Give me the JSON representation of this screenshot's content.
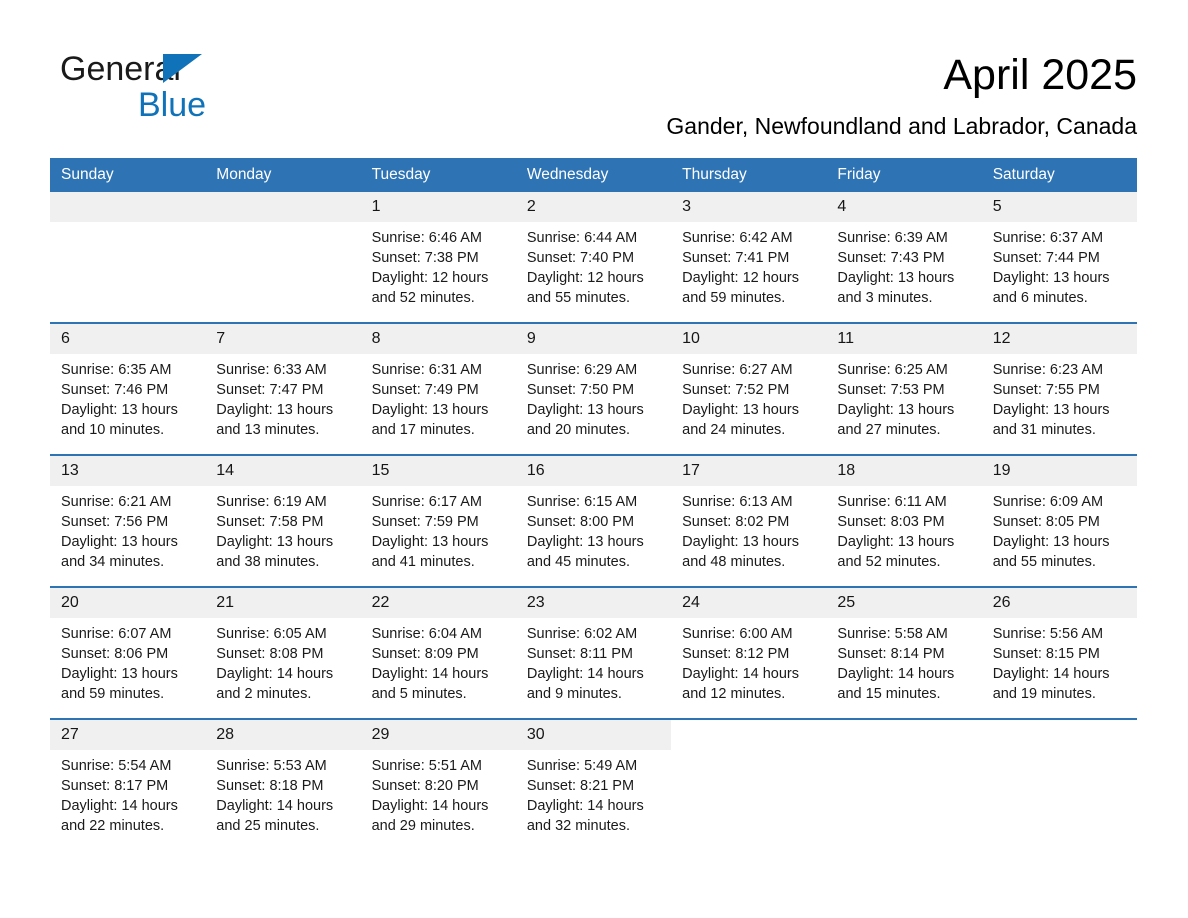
{
  "brand": {
    "word1": "General",
    "word2": "Blue",
    "accent_color": "#1073b9"
  },
  "header": {
    "title": "April 2025",
    "subtitle": "Gander, Newfoundland and Labrador, Canada"
  },
  "theme": {
    "header_bg": "#2e73b3",
    "daynum_bg": "#f0f0f0",
    "page_bg": "#ffffff"
  },
  "weekday_headers": [
    "Sunday",
    "Monday",
    "Tuesday",
    "Wednesday",
    "Thursday",
    "Friday",
    "Saturday"
  ],
  "weeks": [
    [
      {
        "day": "",
        "blank": true,
        "sunrise": "",
        "sunset": "",
        "daylight1": "",
        "daylight2": ""
      },
      {
        "day": "",
        "blank": true,
        "sunrise": "",
        "sunset": "",
        "daylight1": "",
        "daylight2": ""
      },
      {
        "day": "1",
        "sunrise": "Sunrise: 6:46 AM",
        "sunset": "Sunset: 7:38 PM",
        "daylight1": "Daylight: 12 hours",
        "daylight2": "and 52 minutes."
      },
      {
        "day": "2",
        "sunrise": "Sunrise: 6:44 AM",
        "sunset": "Sunset: 7:40 PM",
        "daylight1": "Daylight: 12 hours",
        "daylight2": "and 55 minutes."
      },
      {
        "day": "3",
        "sunrise": "Sunrise: 6:42 AM",
        "sunset": "Sunset: 7:41 PM",
        "daylight1": "Daylight: 12 hours",
        "daylight2": "and 59 minutes."
      },
      {
        "day": "4",
        "sunrise": "Sunrise: 6:39 AM",
        "sunset": "Sunset: 7:43 PM",
        "daylight1": "Daylight: 13 hours",
        "daylight2": "and 3 minutes."
      },
      {
        "day": "5",
        "sunrise": "Sunrise: 6:37 AM",
        "sunset": "Sunset: 7:44 PM",
        "daylight1": "Daylight: 13 hours",
        "daylight2": "and 6 minutes."
      }
    ],
    [
      {
        "day": "6",
        "sunrise": "Sunrise: 6:35 AM",
        "sunset": "Sunset: 7:46 PM",
        "daylight1": "Daylight: 13 hours",
        "daylight2": "and 10 minutes."
      },
      {
        "day": "7",
        "sunrise": "Sunrise: 6:33 AM",
        "sunset": "Sunset: 7:47 PM",
        "daylight1": "Daylight: 13 hours",
        "daylight2": "and 13 minutes."
      },
      {
        "day": "8",
        "sunrise": "Sunrise: 6:31 AM",
        "sunset": "Sunset: 7:49 PM",
        "daylight1": "Daylight: 13 hours",
        "daylight2": "and 17 minutes."
      },
      {
        "day": "9",
        "sunrise": "Sunrise: 6:29 AM",
        "sunset": "Sunset: 7:50 PM",
        "daylight1": "Daylight: 13 hours",
        "daylight2": "and 20 minutes."
      },
      {
        "day": "10",
        "sunrise": "Sunrise: 6:27 AM",
        "sunset": "Sunset: 7:52 PM",
        "daylight1": "Daylight: 13 hours",
        "daylight2": "and 24 minutes."
      },
      {
        "day": "11",
        "sunrise": "Sunrise: 6:25 AM",
        "sunset": "Sunset: 7:53 PM",
        "daylight1": "Daylight: 13 hours",
        "daylight2": "and 27 minutes."
      },
      {
        "day": "12",
        "sunrise": "Sunrise: 6:23 AM",
        "sunset": "Sunset: 7:55 PM",
        "daylight1": "Daylight: 13 hours",
        "daylight2": "and 31 minutes."
      }
    ],
    [
      {
        "day": "13",
        "sunrise": "Sunrise: 6:21 AM",
        "sunset": "Sunset: 7:56 PM",
        "daylight1": "Daylight: 13 hours",
        "daylight2": "and 34 minutes."
      },
      {
        "day": "14",
        "sunrise": "Sunrise: 6:19 AM",
        "sunset": "Sunset: 7:58 PM",
        "daylight1": "Daylight: 13 hours",
        "daylight2": "and 38 minutes."
      },
      {
        "day": "15",
        "sunrise": "Sunrise: 6:17 AM",
        "sunset": "Sunset: 7:59 PM",
        "daylight1": "Daylight: 13 hours",
        "daylight2": "and 41 minutes."
      },
      {
        "day": "16",
        "sunrise": "Sunrise: 6:15 AM",
        "sunset": "Sunset: 8:00 PM",
        "daylight1": "Daylight: 13 hours",
        "daylight2": "and 45 minutes."
      },
      {
        "day": "17",
        "sunrise": "Sunrise: 6:13 AM",
        "sunset": "Sunset: 8:02 PM",
        "daylight1": "Daylight: 13 hours",
        "daylight2": "and 48 minutes."
      },
      {
        "day": "18",
        "sunrise": "Sunrise: 6:11 AM",
        "sunset": "Sunset: 8:03 PM",
        "daylight1": "Daylight: 13 hours",
        "daylight2": "and 52 minutes."
      },
      {
        "day": "19",
        "sunrise": "Sunrise: 6:09 AM",
        "sunset": "Sunset: 8:05 PM",
        "daylight1": "Daylight: 13 hours",
        "daylight2": "and 55 minutes."
      }
    ],
    [
      {
        "day": "20",
        "sunrise": "Sunrise: 6:07 AM",
        "sunset": "Sunset: 8:06 PM",
        "daylight1": "Daylight: 13 hours",
        "daylight2": "and 59 minutes."
      },
      {
        "day": "21",
        "sunrise": "Sunrise: 6:05 AM",
        "sunset": "Sunset: 8:08 PM",
        "daylight1": "Daylight: 14 hours",
        "daylight2": "and 2 minutes."
      },
      {
        "day": "22",
        "sunrise": "Sunrise: 6:04 AM",
        "sunset": "Sunset: 8:09 PM",
        "daylight1": "Daylight: 14 hours",
        "daylight2": "and 5 minutes."
      },
      {
        "day": "23",
        "sunrise": "Sunrise: 6:02 AM",
        "sunset": "Sunset: 8:11 PM",
        "daylight1": "Daylight: 14 hours",
        "daylight2": "and 9 minutes."
      },
      {
        "day": "24",
        "sunrise": "Sunrise: 6:00 AM",
        "sunset": "Sunset: 8:12 PM",
        "daylight1": "Daylight: 14 hours",
        "daylight2": "and 12 minutes."
      },
      {
        "day": "25",
        "sunrise": "Sunrise: 5:58 AM",
        "sunset": "Sunset: 8:14 PM",
        "daylight1": "Daylight: 14 hours",
        "daylight2": "and 15 minutes."
      },
      {
        "day": "26",
        "sunrise": "Sunrise: 5:56 AM",
        "sunset": "Sunset: 8:15 PM",
        "daylight1": "Daylight: 14 hours",
        "daylight2": "and 19 minutes."
      }
    ],
    [
      {
        "day": "27",
        "sunrise": "Sunrise: 5:54 AM",
        "sunset": "Sunset: 8:17 PM",
        "daylight1": "Daylight: 14 hours",
        "daylight2": "and 22 minutes."
      },
      {
        "day": "28",
        "sunrise": "Sunrise: 5:53 AM",
        "sunset": "Sunset: 8:18 PM",
        "daylight1": "Daylight: 14 hours",
        "daylight2": "and 25 minutes."
      },
      {
        "day": "29",
        "sunrise": "Sunrise: 5:51 AM",
        "sunset": "Sunset: 8:20 PM",
        "daylight1": "Daylight: 14 hours",
        "daylight2": "and 29 minutes."
      },
      {
        "day": "30",
        "sunrise": "Sunrise: 5:49 AM",
        "sunset": "Sunset: 8:21 PM",
        "daylight1": "Daylight: 14 hours",
        "daylight2": "and 32 minutes."
      },
      {
        "day": "",
        "blank": true,
        "sunrise": "",
        "sunset": "",
        "daylight1": "",
        "daylight2": ""
      },
      {
        "day": "",
        "blank": true,
        "sunrise": "",
        "sunset": "",
        "daylight1": "",
        "daylight2": ""
      },
      {
        "day": "",
        "blank": true,
        "sunrise": "",
        "sunset": "",
        "daylight1": "",
        "daylight2": ""
      }
    ]
  ]
}
